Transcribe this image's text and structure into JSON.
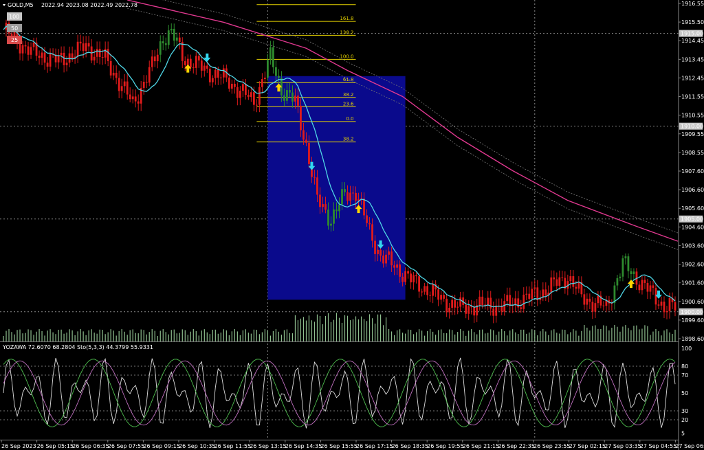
{
  "header": {
    "symbol": "GOLD,M5",
    "ohlc": "2022.94 2023.08 2022.49 2022.78"
  },
  "corner_buttons": [
    "100",
    "50",
    "25"
  ],
  "indicator_label": "YOZAWA 72.6070 68.2804  Sto(5,3,3) 44.3799 55.9331",
  "colors": {
    "background": "#000000",
    "bull_candle": "#2e8b2e",
    "bear_candle": "#e01b1b",
    "ma_fast": "#4fd6e6",
    "ma_slow": "#e0388f",
    "fib": "#e6d200",
    "box": "#0a0a8c",
    "arrow_up": "#ffd400",
    "arrow_down": "#33d6ee",
    "volume": "#8fbf8f"
  },
  "chart_data": {
    "type": "candlestick",
    "price_axis": {
      "ylim": [
        1898.4,
        1916.8
      ],
      "ticks": [
        "1916.55",
        "1915.50",
        "1914.45",
        "1913.45",
        "1912.45",
        "1911.55",
        "1910.55",
        "1909.55",
        "1908.55",
        "1907.60",
        "1906.60",
        "1905.60",
        "1904.60",
        "1903.60",
        "1902.60",
        "1901.60",
        "1900.60",
        "1899.60",
        "1898.60"
      ],
      "highlighted": [
        "1915.00",
        "1910.00",
        "1905.00",
        "1900.00"
      ]
    },
    "time_axis": [
      "26 Sep 2023",
      "26 Sep 05:15",
      "26 Sep 06:35",
      "26 Sep 07:55",
      "26 Sep 09:15",
      "26 Sep 10:35",
      "26 Sep 11:55",
      "26 Sep 13:15",
      "26 Sep 14:35",
      "26 Sep 15:55",
      "26 Sep 17:15",
      "26 Sep 18:35",
      "26 Sep 19:55",
      "26 Sep 21:15",
      "26 Sep 22:35",
      "26 Sep 23:55",
      "27 Sep 02:15",
      "27 Sep 03:35",
      "27 Sep 04:55",
      "27 Sep 06:15"
    ],
    "fibonacci": {
      "levels": [
        {
          "label": "161.8",
          "price": 1915.65
        },
        {
          "label": "138.2",
          "price": 1914.9
        },
        {
          "label": "100.0",
          "price": 1913.6
        },
        {
          "label": "61.8",
          "price": 1912.35
        },
        {
          "label": "38.2",
          "price": 1911.55
        },
        {
          "label": "23.6",
          "price": 1911.05
        },
        {
          "label": "0.0",
          "price": 1910.25
        },
        {
          "label": "38.2",
          "price": 1909.15
        }
      ],
      "top_price": 1916.55
    },
    "highlight_box": {
      "from_index": 96,
      "to_index": 146,
      "price_top": 1912.7,
      "price_bottom": 1900.65
    },
    "oscillator": {
      "ylim": [
        0,
        100
      ],
      "ticks": [
        "100",
        "80",
        "70",
        "50",
        "30",
        "20",
        "5"
      ],
      "levels": [
        80,
        70,
        30,
        20
      ]
    }
  }
}
